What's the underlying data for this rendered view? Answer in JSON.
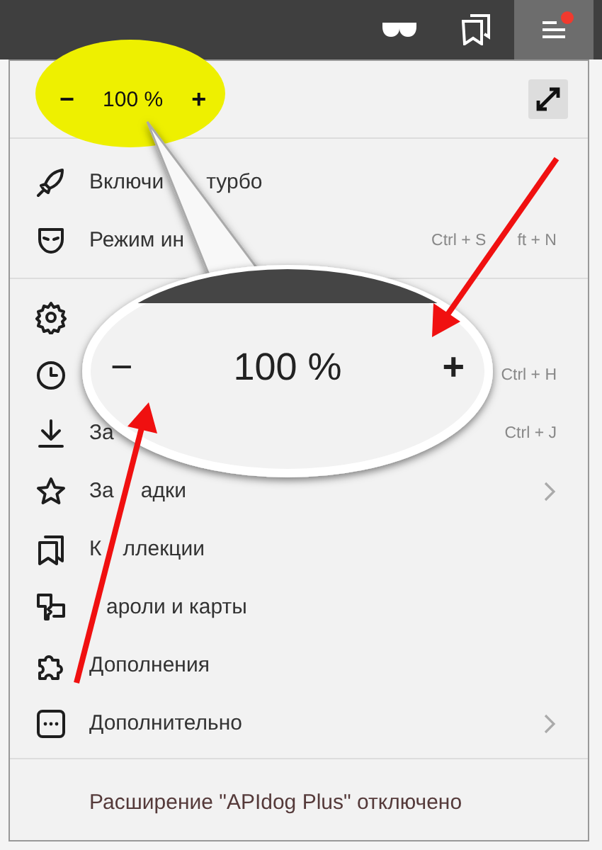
{
  "toolbar": {
    "menu_button": {
      "notification": true
    }
  },
  "zoom": {
    "highlighted": true,
    "minus": "−",
    "value": "100 %",
    "plus": "+"
  },
  "menu": {
    "sections": [
      {
        "items": [
          {
            "label_parts": [
              "Включи",
              "турбо"
            ],
            "submenu": false
          },
          {
            "label_parts": [
              "Режим ин"
            ],
            "shortcut_parts": [
              "Ctrl + S",
              "ft + N"
            ],
            "submenu": false
          }
        ]
      },
      {
        "items": [
          {
            "submenu": false
          },
          {
            "shortcut_parts": [
              "Ctrl + H"
            ],
            "submenu": false
          },
          {
            "label_parts": [
              "За"
            ],
            "shortcut_parts": [
              "Ctrl + J"
            ],
            "submenu": false
          },
          {
            "label_parts": [
              "За",
              "адки"
            ],
            "submenu": true
          },
          {
            "label_parts": [
              "К",
              "ллекции"
            ],
            "submenu": false
          },
          {
            "label_parts": [
              "ароли и карты"
            ],
            "submenu": false
          },
          {
            "label_parts": [
              "Дополнения"
            ],
            "submenu": false
          },
          {
            "label_parts": [
              "Дополнительно"
            ],
            "submenu": true
          }
        ]
      }
    ],
    "footer": "Расширение \"APIdog Plus\" отключено"
  },
  "callout": {
    "minus": "−",
    "value": "100 %",
    "plus": "+"
  }
}
